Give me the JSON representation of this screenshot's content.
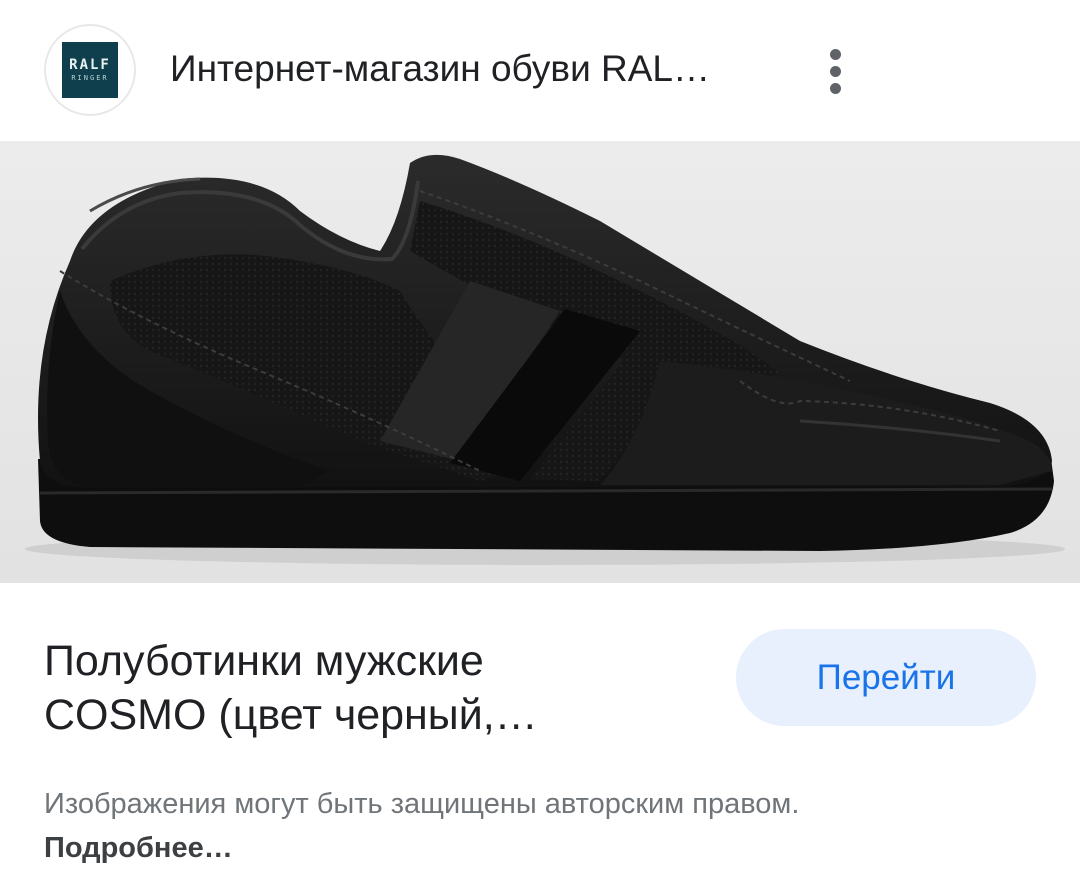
{
  "header": {
    "logo": {
      "line1": "RALF",
      "line2": "RINGER",
      "background": "#0f3f4c"
    },
    "site_title": "Интернет-магазин обуви RAL…",
    "more_icon": "more-vert-icon"
  },
  "image": {
    "subject": "shoe-image",
    "background": "#e9e9e9"
  },
  "product": {
    "title_line1": "Полуботинки мужские",
    "title_line2": "COSMO (цвет черный,…"
  },
  "go_button": {
    "label": "Перейти",
    "color": "#1a73e8",
    "background": "#e8f0fe"
  },
  "copyright": {
    "text": "Изображения могут быть защищены авторским правом.",
    "link": "Подробнее…"
  }
}
